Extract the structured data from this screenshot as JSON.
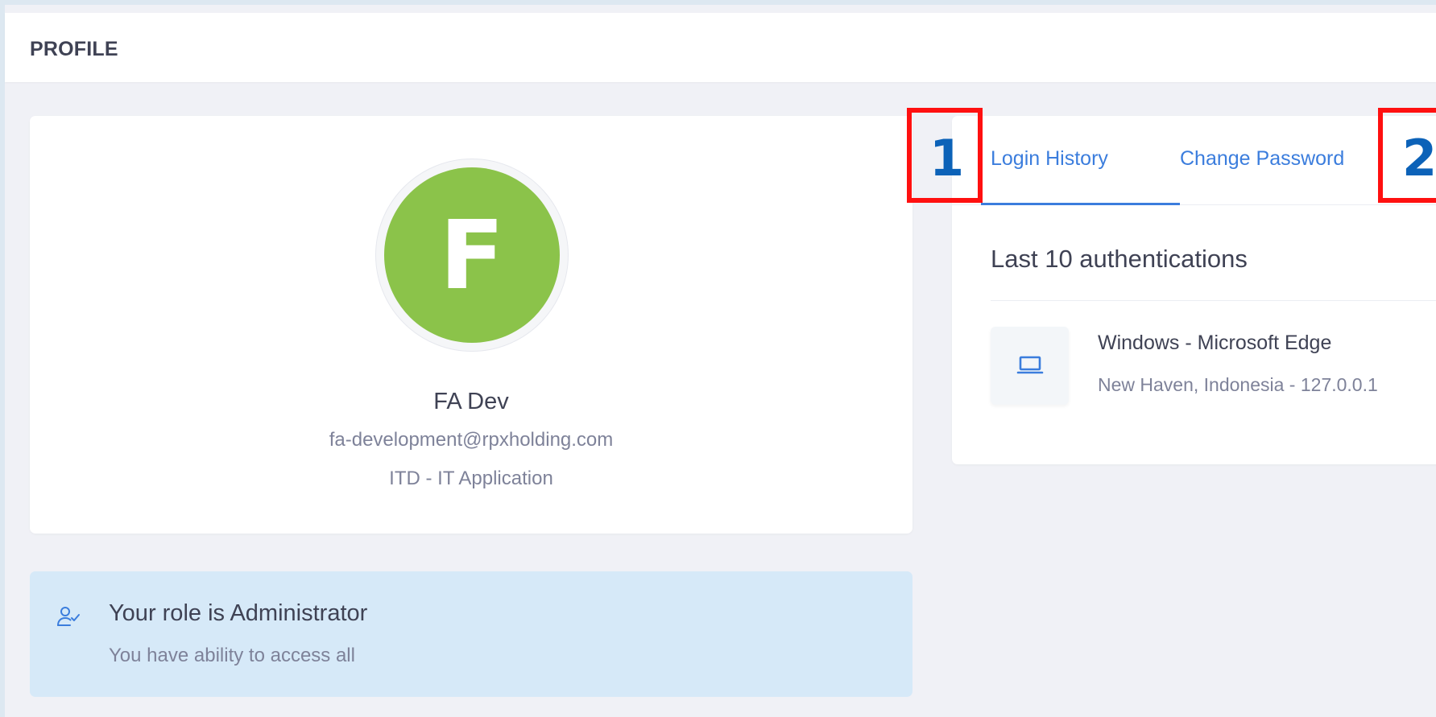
{
  "header": {
    "title": "PROFILE"
  },
  "profile": {
    "avatar_letter": "F",
    "avatar_color": "#8bc34a",
    "name": "FA Dev",
    "email": "fa-development@rpxholding.com",
    "department": "ITD - IT Application"
  },
  "role": {
    "icon": "user-check-icon",
    "title": "Your role is Administrator",
    "description": "You have ability to access all"
  },
  "tabs": [
    {
      "label": "Login History",
      "active": true
    },
    {
      "label": "Change Password",
      "active": false
    }
  ],
  "login_history": {
    "title": "Last 10 authentications",
    "sessions": [
      {
        "icon": "laptop-icon",
        "device": "Windows - Microsoft Edge",
        "location": "New Haven, Indonesia - 127.0.0.1"
      }
    ]
  },
  "markers": [
    {
      "label": "1",
      "color": "#ff1010"
    },
    {
      "label": "2",
      "color": "#ff1010"
    }
  ],
  "colors": {
    "accent": "#3b7ddd",
    "role_background": "#d6e9f8",
    "marker_label": "#0c62b8"
  }
}
